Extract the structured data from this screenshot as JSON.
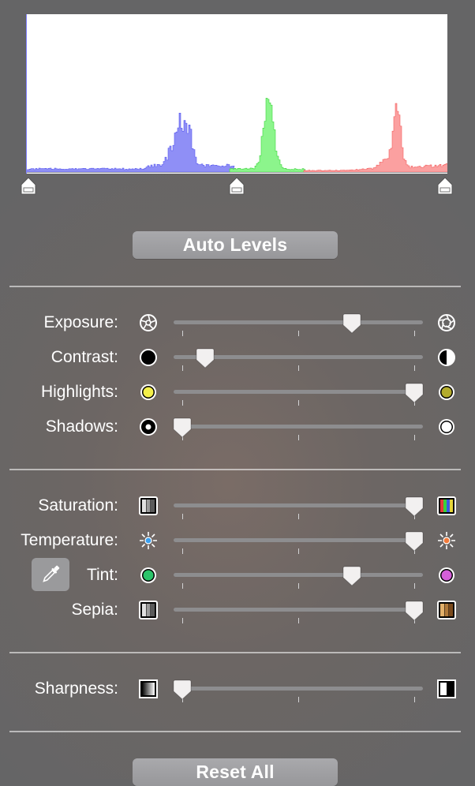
{
  "histogram": {
    "channels": [
      {
        "name": "blue",
        "color": "#8f8ff6",
        "peak": "#5959f0"
      },
      {
        "name": "green",
        "color": "#8cf58c",
        "peak": "#3ed63e"
      },
      {
        "name": "red",
        "color": "#fba0a0",
        "peak": "#f45f5f"
      }
    ]
  },
  "levels": {
    "black_point": 0.0,
    "midtone": 0.5,
    "white_point": 1.0
  },
  "buttons": {
    "auto_levels": "Auto Levels",
    "reset_all": "Reset All"
  },
  "groups": [
    {
      "id": "tone",
      "sliders": [
        {
          "id": "exposure",
          "label": "Exposure:",
          "value": 0.73,
          "left_icon": "aperture-closed-icon",
          "right_icon": "aperture-open-icon"
        },
        {
          "id": "contrast",
          "label": "Contrast:",
          "value": 0.1,
          "left_icon": "black-circle-icon",
          "right_icon": "half-circle-icon"
        },
        {
          "id": "highlights",
          "label": "Highlights:",
          "value": 1.0,
          "left_icon": "yellow-circle-icon",
          "right_icon": "olive-circle-icon"
        },
        {
          "id": "shadows",
          "label": "Shadows:",
          "value": 0.0,
          "left_icon": "dot-circle-icon",
          "right_icon": "white-circle-icon"
        }
      ]
    },
    {
      "id": "color",
      "sliders": [
        {
          "id": "saturation",
          "label": "Saturation:",
          "value": 1.0,
          "left_icon": "grayscale-bars-icon",
          "right_icon": "color-bars-icon"
        },
        {
          "id": "temperature",
          "label": "Temperature:",
          "value": 1.0,
          "left_icon": "cool-sun-icon",
          "right_icon": "warm-sun-icon"
        },
        {
          "id": "tint",
          "label": "Tint:",
          "value": 0.73,
          "left_icon": "green-circle-icon",
          "right_icon": "magenta-circle-icon"
        },
        {
          "id": "sepia",
          "label": "Sepia:",
          "value": 1.0,
          "left_icon": "grayscale-bars-icon",
          "right_icon": "sepia-bars-icon"
        }
      ]
    },
    {
      "id": "detail",
      "sliders": [
        {
          "id": "sharpness",
          "label": "Sharpness:",
          "value": 0.0,
          "left_icon": "soft-edge-icon",
          "right_icon": "sharp-edge-icon"
        }
      ]
    }
  ],
  "colors": {
    "yellow": "#f3ef4a",
    "olive": "#b3ab2c",
    "green": "#2bc46a",
    "magenta": "#d45fd8",
    "cool": "#3ba0f0",
    "warm": "#f27a3a",
    "sepia": "#b0793a"
  }
}
